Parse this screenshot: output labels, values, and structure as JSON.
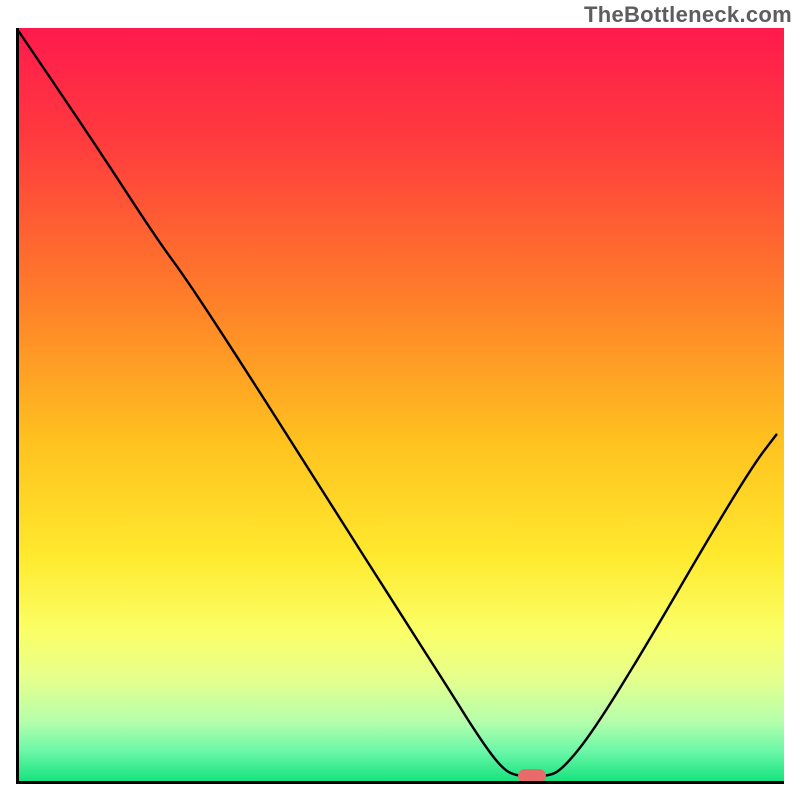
{
  "watermark": "TheBottleneck.com",
  "colors": {
    "axis": "#000000",
    "curve": "#000000",
    "marker": "#e86a6a",
    "gradient_stops": [
      {
        "offset": 0.0,
        "color": "#ff1a4d"
      },
      {
        "offset": 0.15,
        "color": "#ff3b3e"
      },
      {
        "offset": 0.35,
        "color": "#ff7b2a"
      },
      {
        "offset": 0.55,
        "color": "#ffc21f"
      },
      {
        "offset": 0.7,
        "color": "#ffe92e"
      },
      {
        "offset": 0.8,
        "color": "#faff66"
      },
      {
        "offset": 0.86,
        "color": "#e8ff8a"
      },
      {
        "offset": 0.92,
        "color": "#b7ffac"
      },
      {
        "offset": 0.96,
        "color": "#6cf7a8"
      },
      {
        "offset": 1.0,
        "color": "#16e37e"
      }
    ]
  },
  "chart_data": {
    "type": "line",
    "title": "",
    "xlabel": "",
    "ylabel": "",
    "xlim": [
      0,
      100
    ],
    "ylim": [
      0,
      100
    ],
    "series": [
      {
        "name": "curve",
        "points": [
          {
            "x": 0.0,
            "y": 99.5
          },
          {
            "x": 10.0,
            "y": 84.5
          },
          {
            "x": 18.0,
            "y": 72.0
          },
          {
            "x": 22.0,
            "y": 66.5
          },
          {
            "x": 30.0,
            "y": 54.0
          },
          {
            "x": 40.0,
            "y": 38.0
          },
          {
            "x": 50.0,
            "y": 22.0
          },
          {
            "x": 56.0,
            "y": 12.5
          },
          {
            "x": 60.0,
            "y": 6.0
          },
          {
            "x": 63.0,
            "y": 1.8
          },
          {
            "x": 65.0,
            "y": 0.6
          },
          {
            "x": 69.0,
            "y": 0.6
          },
          {
            "x": 71.0,
            "y": 1.5
          },
          {
            "x": 75.0,
            "y": 6.5
          },
          {
            "x": 82.0,
            "y": 18.0
          },
          {
            "x": 90.0,
            "y": 32.0
          },
          {
            "x": 96.0,
            "y": 42.0
          },
          {
            "x": 99.0,
            "y": 46.0
          }
        ]
      }
    ],
    "marker": {
      "x": 67.0,
      "y": 0.6
    }
  }
}
